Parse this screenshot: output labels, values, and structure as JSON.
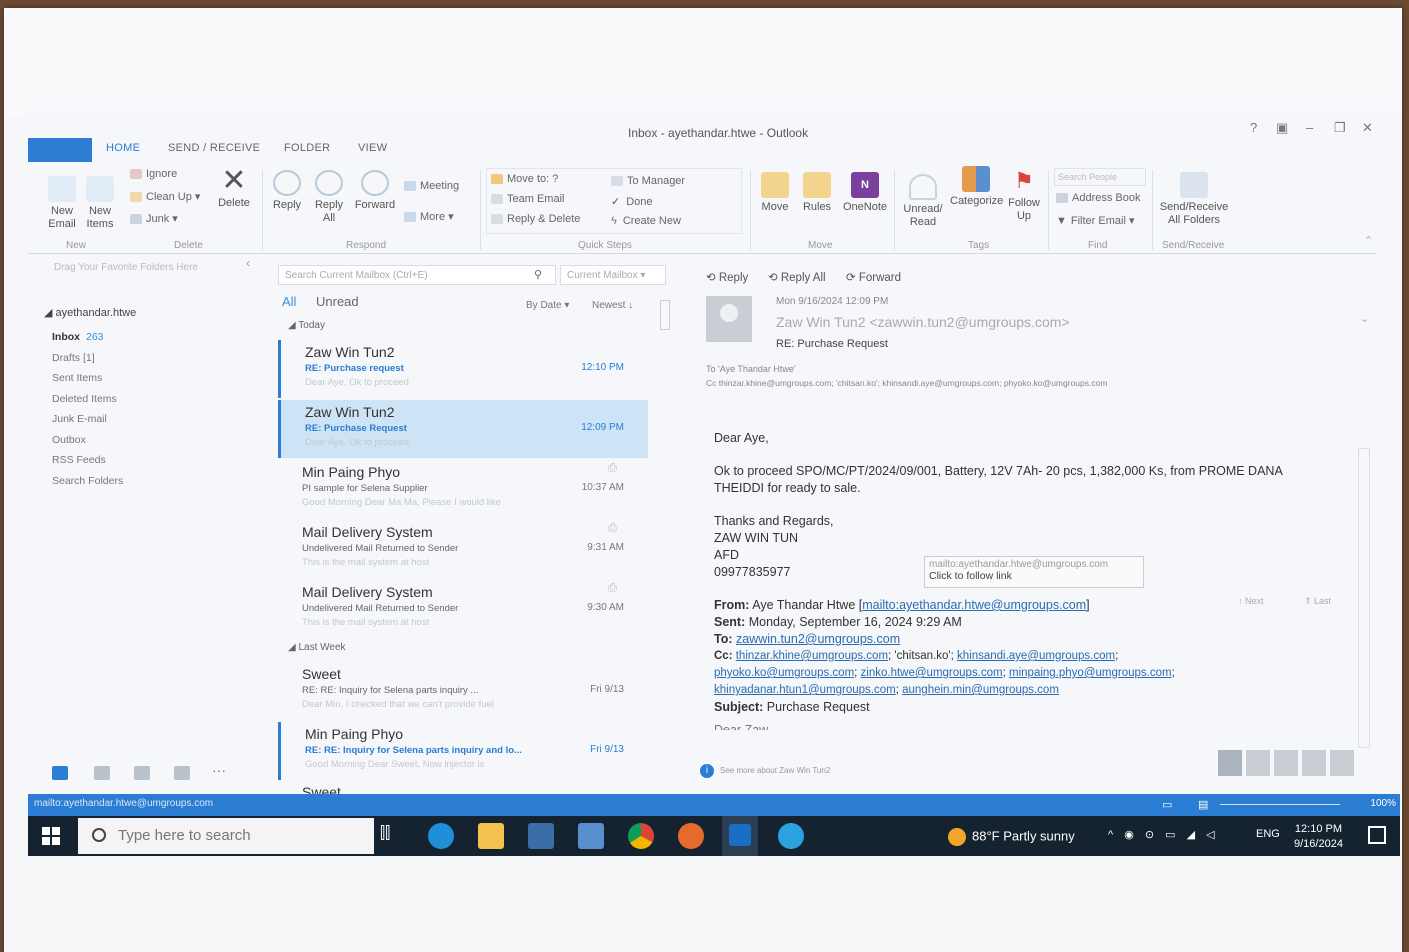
{
  "window": {
    "title": "Inbox - ayethandar.htwe - Outlook"
  },
  "tabs": [
    "HOME",
    "SEND / RECEIVE",
    "FOLDER",
    "VIEW"
  ],
  "ribbon": {
    "new_email": "New Email",
    "new_items": "New Items",
    "ignore": "Ignore",
    "clean_up": "Clean Up",
    "junk": "Junk",
    "delete": "Delete",
    "reply": "Reply",
    "reply_all": "Reply All",
    "forward": "Forward",
    "meeting": "Meeting",
    "more": "More",
    "quick_steps": [
      "Move to: ?",
      "Team Email",
      "Reply & Delete",
      "To Manager",
      "Done",
      "Create New"
    ],
    "move": "Move",
    "rules": "Rules",
    "onenote": "OneNote",
    "unread_read": "Unread/ Read",
    "categorize": "Categorize",
    "follow_up": "Follow Up",
    "search_people": "Search People",
    "address_book": "Address Book",
    "filter_email": "Filter Email",
    "send_receive_all": "Send/Receive All Folders",
    "groups": [
      "New",
      "Delete",
      "Respond",
      "Quick Steps",
      "Move",
      "Tags",
      "Find",
      "Send/Receive"
    ]
  },
  "sidebar": {
    "favorites_hint": "Drag Your Favorite Folders Here",
    "account": "ayethandar.htwe",
    "folders": [
      {
        "label": "Inbox",
        "count": "263"
      },
      {
        "label": "Drafts",
        "count": "[1]"
      },
      {
        "label": "Sent Items",
        "count": ""
      },
      {
        "label": "Deleted Items",
        "count": ""
      },
      {
        "label": "Junk E-mail",
        "count": ""
      },
      {
        "label": "Outbox",
        "count": ""
      },
      {
        "label": "RSS Feeds",
        "count": ""
      },
      {
        "label": "Search Folders",
        "count": ""
      }
    ]
  },
  "mail_list": {
    "search_placeholder": "Search Current Mailbox (Ctrl+E)",
    "scope": "Current Mailbox",
    "filter_all": "All",
    "filter_unread": "Unread",
    "sort_by": "By Date",
    "sort_order": "Newest",
    "group_today": "Today",
    "group_last_week": "Last Week",
    "messages": [
      {
        "sender": "Zaw Win Tun2",
        "subject": "RE: Purchase request",
        "preview": "Dear Aye,  Ok to proceed",
        "time": "12:10 PM"
      },
      {
        "sender": "Zaw Win Tun2",
        "subject": "RE: Purchase Request",
        "preview": "Dear Aye,  Ok to proceed",
        "time": "12:09 PM"
      },
      {
        "sender": "Min Paing Phyo",
        "subject": "PI sample for Selena Supplier",
        "preview": "Good Morning Dear Ma Ma,  Please I would like",
        "time": "10:37 AM"
      },
      {
        "sender": "Mail Delivery System",
        "subject": "Undelivered Mail Returned to Sender",
        "preview": "This is the mail system at host",
        "time": "9:31 AM"
      },
      {
        "sender": "Mail Delivery System",
        "subject": "Undelivered Mail Returned to Sender",
        "preview": "This is the mail system at host",
        "time": "9:30 AM"
      },
      {
        "sender": "Sweet",
        "subject": "RE: RE: Inquiry for Selena parts inquiry ...",
        "preview": "Dear Min,  I checked that we can't provide fuel",
        "time": "Fri 9/13"
      },
      {
        "sender": "Min Paing Phyo",
        "subject": "RE: RE: Inquiry for Selena parts inquiry and lo...",
        "preview": "Good Morning Dear Sweet,  Now injector is",
        "time": "Fri 9/13"
      },
      {
        "sender": "Sweet",
        "subject": "",
        "preview": "",
        "time": ""
      }
    ]
  },
  "reading": {
    "reply": "Reply",
    "reply_all": "Reply All",
    "forward": "Forward",
    "date": "Mon 9/16/2024 12:09 PM",
    "from": "Zaw Win Tun2 <zawwin.tun2@umgroups.com>",
    "subject": "RE: Purchase Request",
    "to": "To   'Aye Thandar Htwe'",
    "cc": "Cc   thinzar.khine@umgroups.com; 'chitsan.ko'; khinsandi.aye@umgroups.com; phyoko.ko@umgroups.com",
    "greeting": "Dear Aye,",
    "line1": "Ok to proceed SPO/MC/PT/2024/09/001, Battery, 12V 7Ah- 20 pcs, 1,382,000 Ks, from PROME DANA",
    "line2": "THEIDDI for ready to sale.",
    "sign1": "Thanks and Regards,",
    "sign2": "ZAW WIN TUN",
    "sign3": "AFD",
    "sign4": "09977835977",
    "tooltip_url": "mailto:ayethandar.htwe@umgroups.com",
    "tooltip_hint": "Click to follow link",
    "next": "Next",
    "last": "Last",
    "q_from_label": "From:",
    "q_from": "Aye Thandar Htwe [",
    "q_from_link": "mailto:ayethandar.htwe@umgroups.com",
    "q_from_end": "]",
    "q_sent_label": "Sent:",
    "q_sent": "Monday, September 16, 2024 9:29 AM",
    "q_to_label": "To:",
    "q_to": "zawwin.tun2@umgroups.com",
    "q_cc_label": "Cc:",
    "q_cc1": "thinzar.khine@umgroups.com",
    "q_cc_mid": "; 'chitsan.ko'; ",
    "q_cc2": "khinsandi.aye@umgroups.com",
    "q_cc3": "phyoko.ko@umgroups.com",
    "q_cc4": "zinko.htwe@umgroups.com",
    "q_cc5": "minpaing.phyo@umgroups.com",
    "q_cc6": "khinyadanar.htun1@umgroups.com",
    "q_cc7": "aunghein.min@umgroups.com",
    "q_subject_label": "Subject:",
    "q_subject": "Purchase Request",
    "q_cut": "Dear Zaw",
    "people_pane": "See more about Zaw Win Tun2"
  },
  "status": {
    "link": "mailto:ayethandar.htwe@umgroups.com",
    "zoom": "100%"
  },
  "taskbar": {
    "search": "Type here to search",
    "weather": "88°F  Partly sunny",
    "lang": "ENG",
    "time": "12:10 PM",
    "date": "9/16/2024"
  },
  "colors": {
    "accent": "#2b7cd3",
    "selected": "#cde4f7",
    "taskbar": "#152331"
  }
}
